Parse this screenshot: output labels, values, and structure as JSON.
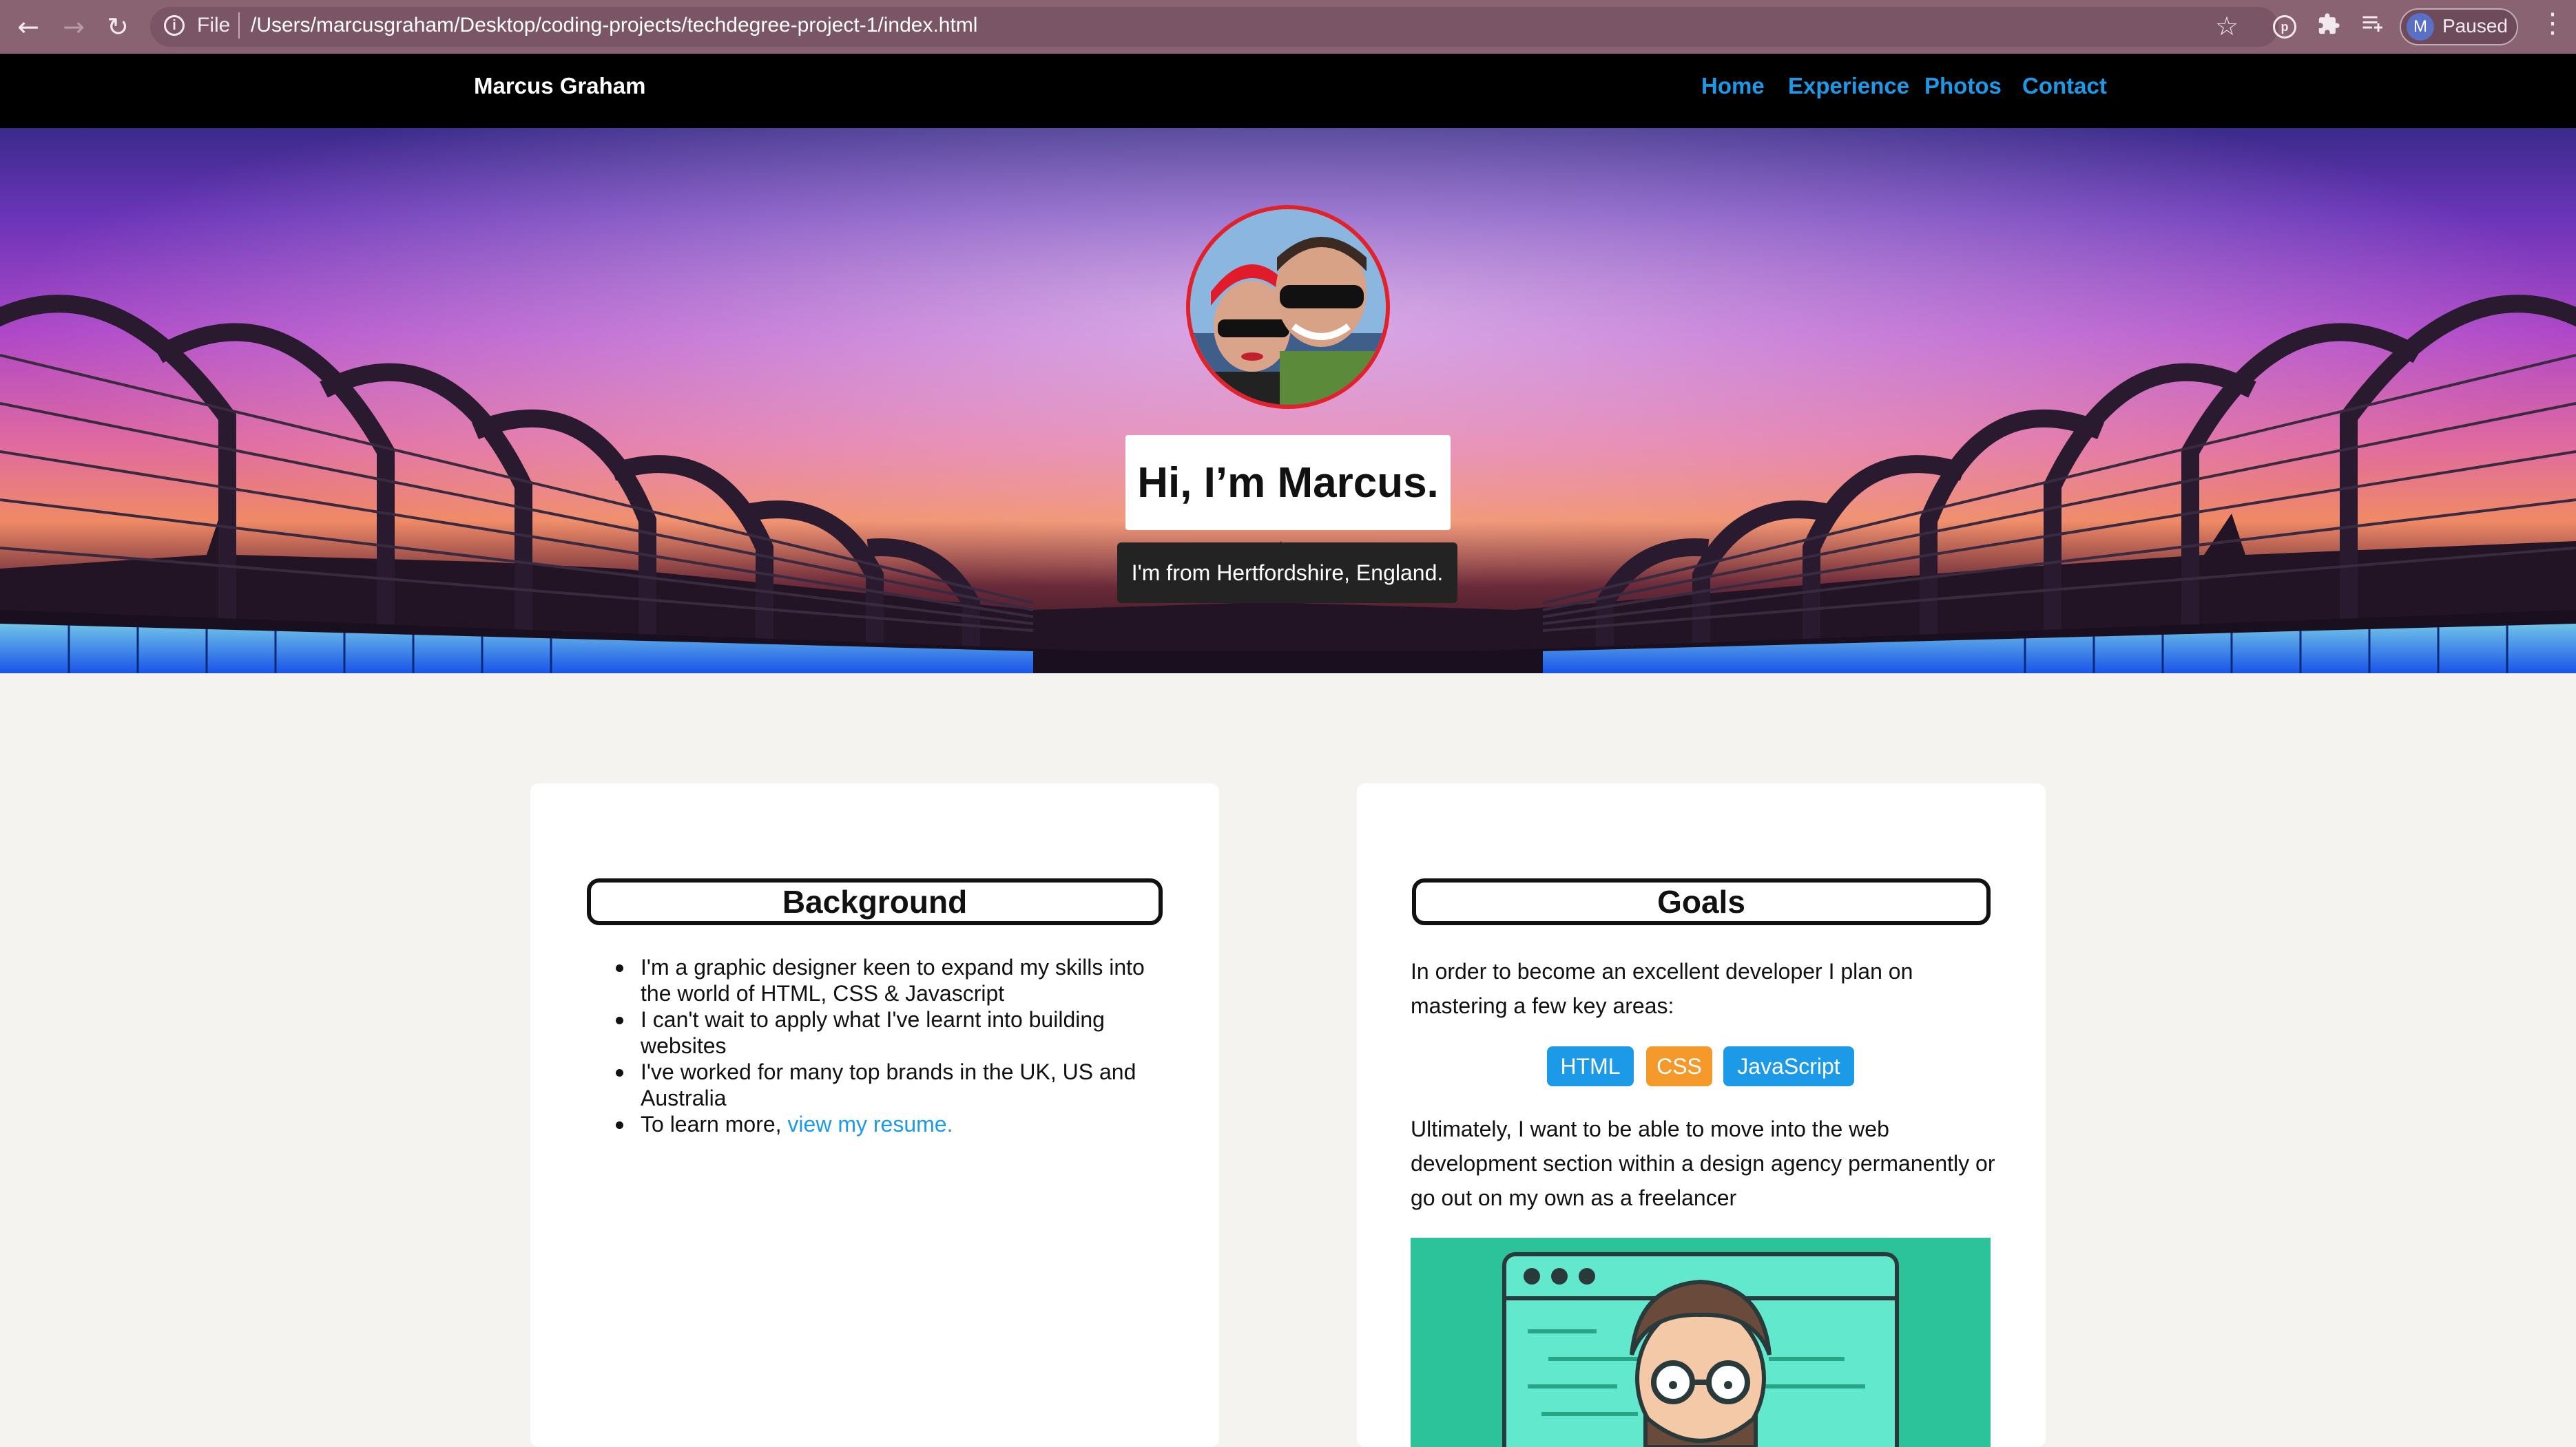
{
  "browser": {
    "scheme_label": "File",
    "url": "/Users/marcusgraham/Desktop/coding-projects/techdegree-project-1/index.html",
    "profile_initial": "M",
    "profile_status": "Paused"
  },
  "site": {
    "brand": "Marcus Graham",
    "nav": [
      "Home",
      "Experience",
      "Photos",
      "Contact"
    ],
    "link_color": "#1c9ae8"
  },
  "hero": {
    "title": "Hi, I’m Marcus.",
    "subtitle": "I'm from Hertfordshire, England.",
    "portrait_border_color": "#e2222b"
  },
  "background": {
    "heading": "Background",
    "items": [
      "I'm a graphic designer keen to expand my skills into the world of HTML, CSS & Javascript",
      "I can't wait to apply what I've learnt into building websites",
      "I've worked for many top brands in the UK, US and Australia"
    ],
    "last_item_prefix": "To learn more, ",
    "last_item_link": "view my resume."
  },
  "goals": {
    "heading": "Goals",
    "intro": "In order to become an excellent developer I plan on mastering a few key areas:",
    "skills": [
      {
        "label": "HTML",
        "color": "#1c9ae8"
      },
      {
        "label": "CSS",
        "color": "#f59a2a"
      },
      {
        "label": "JavaScript",
        "color": "#1c9ae8"
      }
    ],
    "outro": "Ultimately, I want to be able to move into the web development section within a design agency permanently or go out on my own as a freelancer"
  }
}
